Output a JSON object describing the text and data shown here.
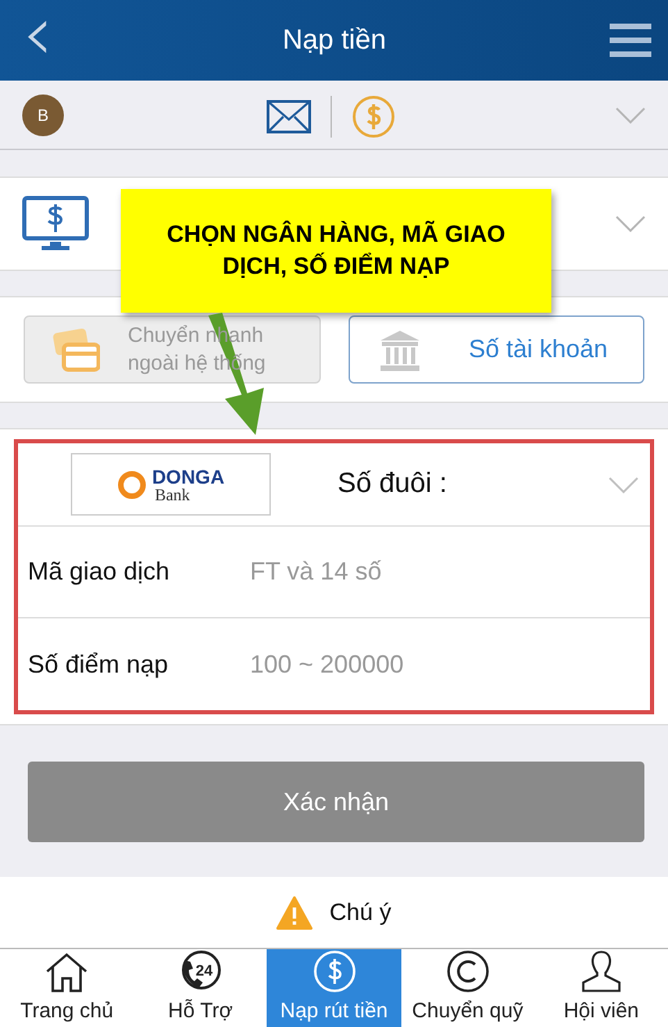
{
  "header": {
    "back": "‹",
    "title": "Nạp tiền"
  },
  "account": {
    "avatar": "B"
  },
  "callout": {
    "text": "CHỌN NGÂN HÀNG, MÃ GIAO DỊCH, SỐ ĐIỂM NẠP"
  },
  "methods": [
    {
      "label": "Chuyển nhanh ngoài hệ thống",
      "selected": false,
      "kind": "card"
    },
    {
      "label": "Số tài khoản",
      "selected": true,
      "kind": "bank"
    }
  ],
  "bank": {
    "logo_name": "DONGA",
    "logo_sub": "Bank",
    "suffix_label": "Số đuôi :"
  },
  "fields": [
    {
      "label": "Mã giao dịch",
      "placeholder": "FT và 14 số"
    },
    {
      "label": "Số điểm nạp",
      "placeholder": "100 ~ 200000"
    }
  ],
  "submit": "Xác nhận",
  "notice": "Chú ý",
  "tabs": [
    {
      "label": "Trang chủ",
      "kind": "home",
      "selected": false
    },
    {
      "label": "Hỗ Trợ",
      "kind": "support",
      "badge": "24",
      "selected": false
    },
    {
      "label": "Nạp rút tiền",
      "kind": "money",
      "selected": true
    },
    {
      "label": "Chuyển quỹ",
      "kind": "transfer",
      "selected": false
    },
    {
      "label": "Hội viên",
      "kind": "member",
      "selected": false
    }
  ]
}
